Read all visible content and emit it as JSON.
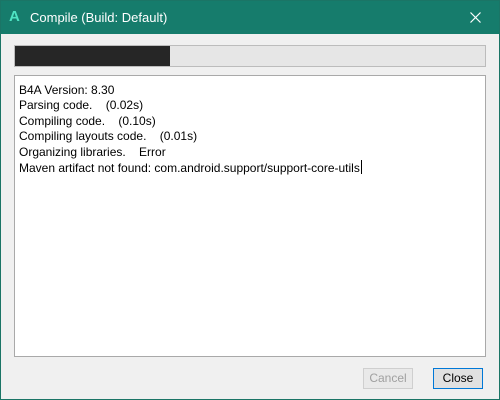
{
  "window": {
    "title": "Compile (Build: Default)",
    "app_icon_letter": "A"
  },
  "progress": {
    "fraction": 0.33
  },
  "log": {
    "lines": [
      "B4A Version: 8.30",
      "Parsing code.    (0.02s)",
      "Compiling code.    (0.10s)",
      "Compiling layouts code.    (0.01s)",
      "Organizing libraries.    Error",
      "Maven artifact not found: com.android.support/support-core-utils"
    ]
  },
  "buttons": {
    "cancel_label": "Cancel",
    "close_label": "Close"
  },
  "colors": {
    "titlebar": "#167c6c",
    "progress_fill": "#262626"
  }
}
